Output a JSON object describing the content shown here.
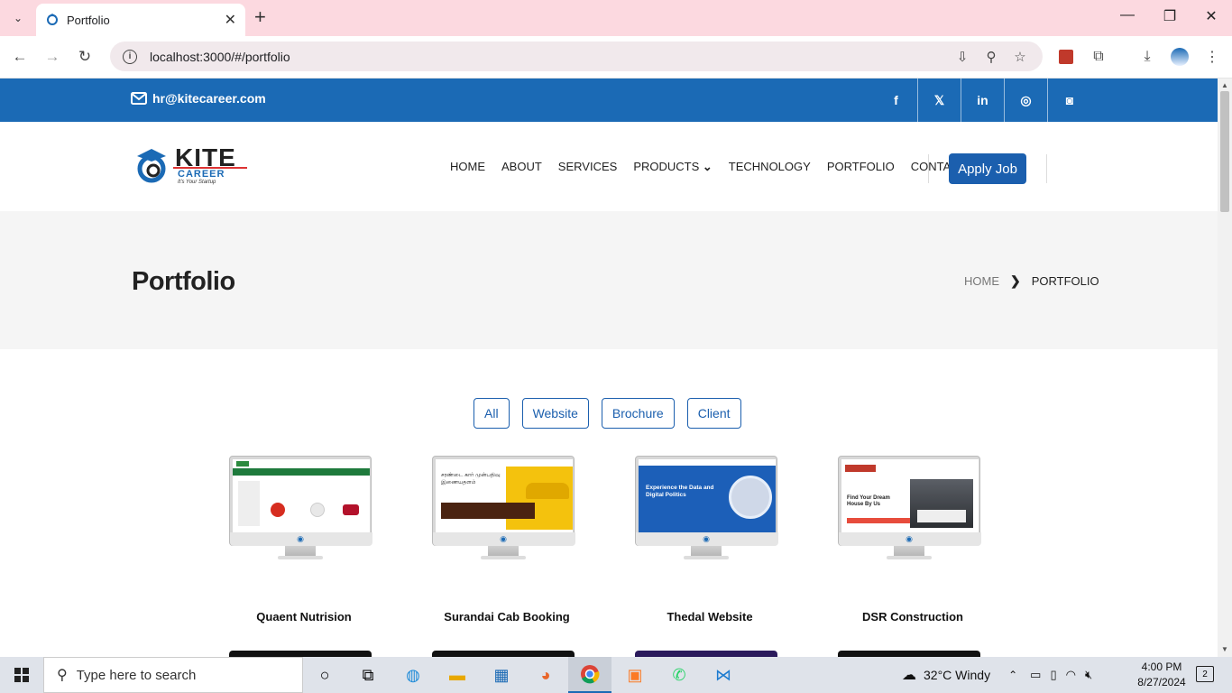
{
  "browser": {
    "tab_title": "Portfolio",
    "tab_close": "✕",
    "new_tab": "+",
    "url": "localhost:3000/#/portfolio",
    "window_minimize": "—",
    "window_restore": "❐",
    "window_close": "✕"
  },
  "topbar": {
    "email": "hr@kitecareer.com",
    "social": [
      "f",
      "𝕏",
      "in",
      "◎",
      "◙"
    ]
  },
  "header": {
    "logo_text": "KITE",
    "logo_sub": "CAREER",
    "logo_tag": "It's Your Startup",
    "nav": [
      "HOME",
      "ABOUT",
      "SERVICES",
      "PRODUCTS",
      "TECHNOLOGY",
      "PORTFOLIO",
      "CONTACT"
    ],
    "products_caret": "⌄",
    "apply_label": "Apply Job"
  },
  "hero": {
    "title": "Portfolio",
    "crumb_home": "HOME",
    "crumb_sep": "❯",
    "crumb_current": "PORTFOLIO"
  },
  "filters": [
    "All",
    "Website",
    "Brochure",
    "Client"
  ],
  "projects": [
    {
      "title": "Quaent Nutrision"
    },
    {
      "title": "Surandai Cab Booking",
      "screen_text": "சரண்டை கார் முன்பதிவு இணையதளம்"
    },
    {
      "title": "Thedal Website",
      "screen_text": "Experience the Data and Digital Politics"
    },
    {
      "title": "DSR Construction",
      "screen_text": "Find Your Dream House By Us"
    }
  ],
  "taskbar": {
    "search_placeholder": "Type here to search",
    "weather": "32°C  Windy",
    "time": "4:00 PM",
    "date": "8/27/2024",
    "notifications": "2"
  },
  "colors": {
    "brand_blue": "#1b6ab5",
    "apply_blue": "#1b5fae",
    "tab_strip": "#fcd9e0"
  }
}
